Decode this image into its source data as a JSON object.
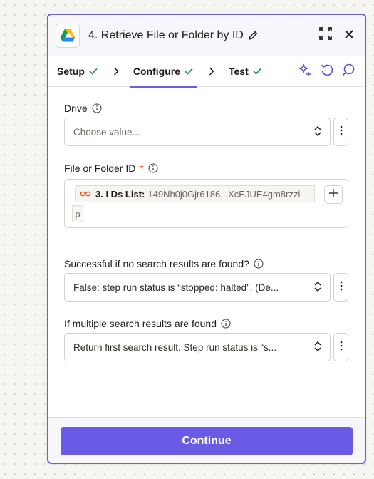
{
  "header": {
    "title": "4. Retrieve File or Folder by ID",
    "icons": [
      "google-drive-icon",
      "edit-icon",
      "expand-icon",
      "close-icon"
    ]
  },
  "steps": [
    {
      "label": "Setup",
      "done": true
    },
    {
      "label": "Configure",
      "done": true,
      "active": true
    },
    {
      "label": "Test",
      "done": true
    }
  ],
  "step_tools": [
    "ai-sparkle-icon",
    "rotate-icon",
    "comment-icon"
  ],
  "fields": {
    "drive": {
      "label": "Drive",
      "placeholder": "Choose value..."
    },
    "file_id": {
      "label": "File or Folder ID",
      "required_mark": "*",
      "pill_step": "3. I Ds List:",
      "pill_value": "149Nh0j0Gjr6186...XcEJUE4gm8rzzi",
      "pill_cont": "p"
    },
    "no_results": {
      "label": "Successful if no search results are found?",
      "value": "False: step run status is “stopped: halted”. (De..."
    },
    "multiple": {
      "label": "If multiple search results are found",
      "value": "Return first search result. Step run status is “s..."
    }
  },
  "footer": {
    "continue_label": "Continue"
  },
  "colors": {
    "accent": "#695be6",
    "border_accent": "#6a5fd6",
    "check": "#2e8b57",
    "required": "#e05a2b"
  }
}
